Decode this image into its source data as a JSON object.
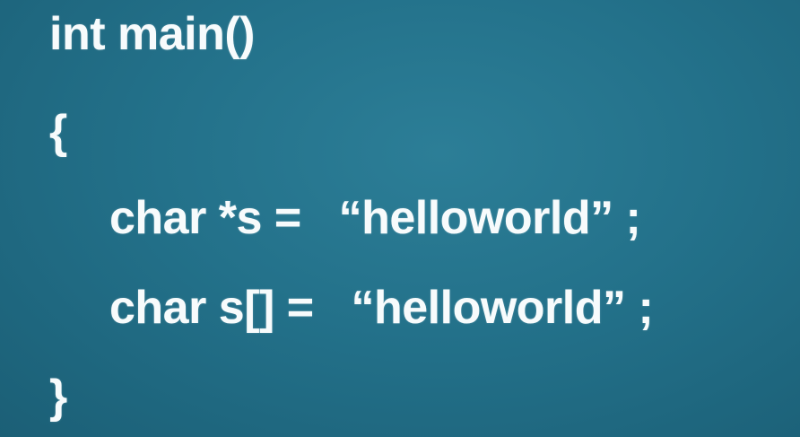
{
  "code_lines": [
    "int main()",
    "{",
    "char *s =   “helloworld” ;",
    "char s[] =   “helloworld” ;",
    "}"
  ]
}
